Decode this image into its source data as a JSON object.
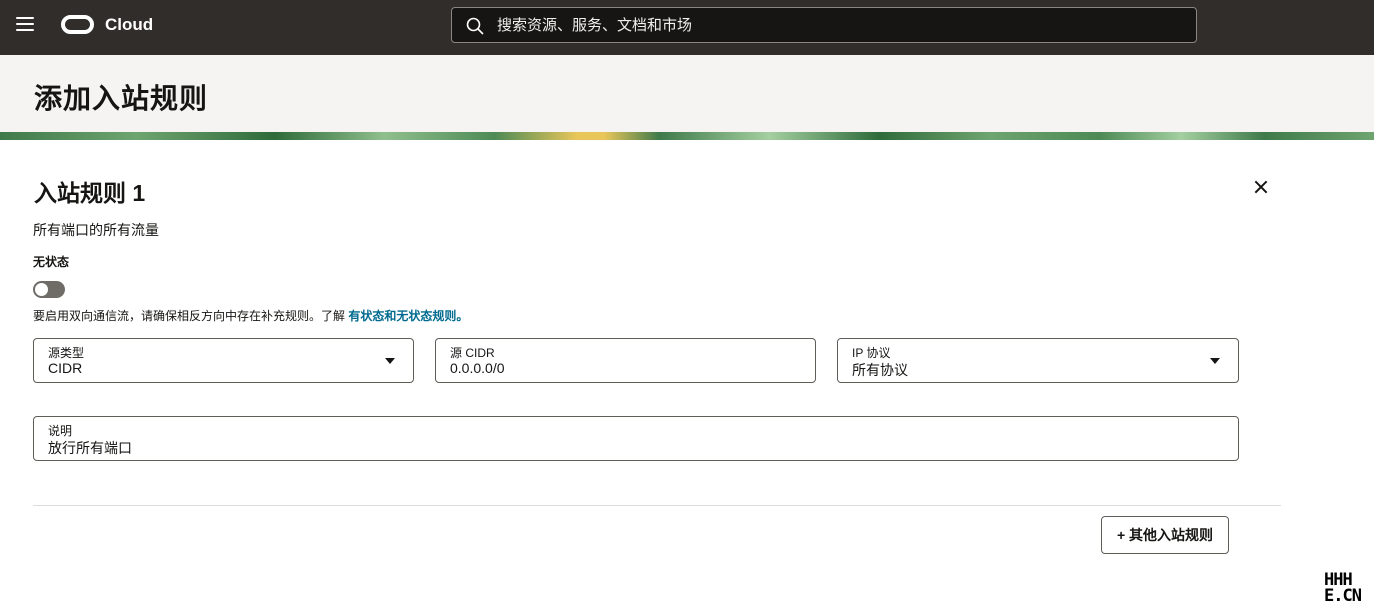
{
  "topbar": {
    "brand": "Cloud",
    "search_placeholder": "搜索资源、服务、文档和市场"
  },
  "page": {
    "title": "添加入站规则"
  },
  "rule": {
    "title": "入站规则 1",
    "subtitle": "所有端口的所有流量",
    "stateless_label": "无状态",
    "stateless_enabled": false,
    "helper_text": "要启用双向通信流，请确保相反方向中存在补充规则。了解 ",
    "helper_link": "有状态和无状态规则。",
    "fields": {
      "source_type": {
        "label": "源类型",
        "value": "CIDR"
      },
      "source_cidr": {
        "label": "源 CIDR",
        "value": "0.0.0.0/0"
      },
      "ip_protocol": {
        "label": "IP 协议",
        "value": "所有协议"
      },
      "description": {
        "label": "说明",
        "value": "放行所有端口"
      }
    }
  },
  "actions": {
    "add_rule": "+ 其他入站规则"
  },
  "watermark": {
    "line1": "HHH",
    "line2": "E.CN"
  }
}
